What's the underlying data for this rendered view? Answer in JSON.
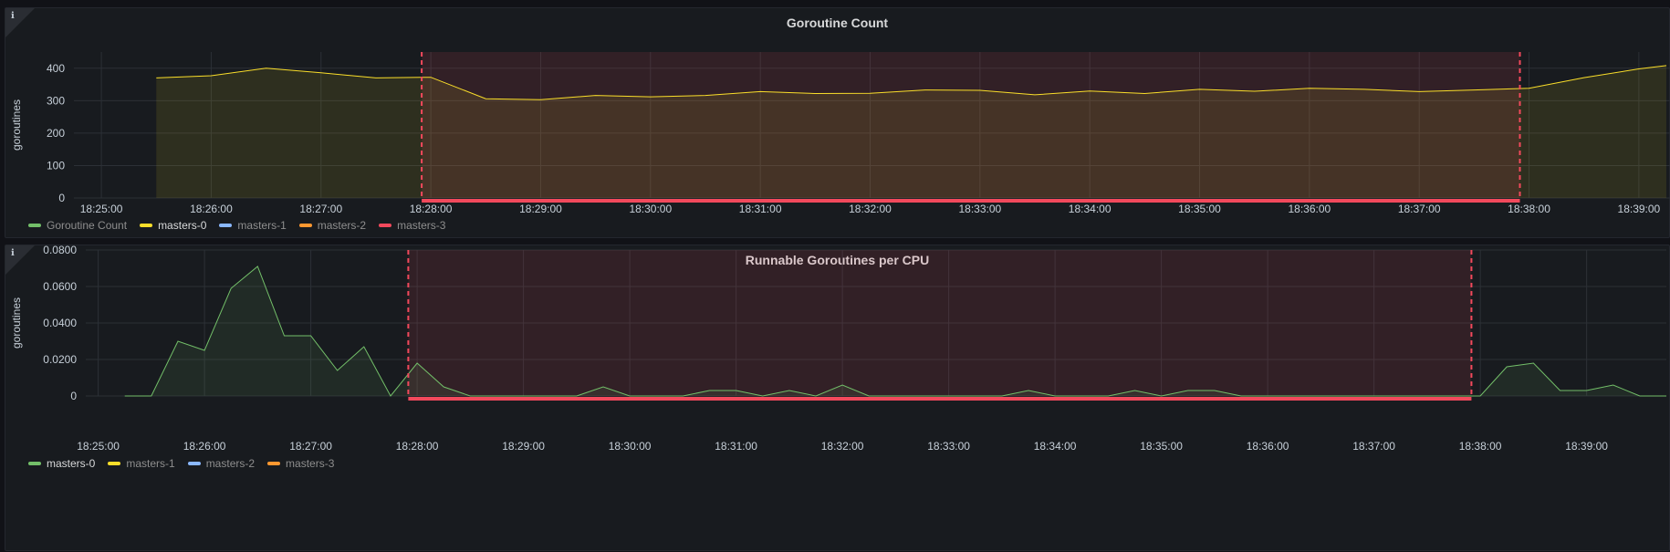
{
  "panels": [
    {
      "title": "Goroutine Count",
      "info_icon": "ℹ",
      "chart_data": {
        "type": "area",
        "title": "Goroutine Count",
        "ylabel": "goroutines",
        "ylim": [
          0,
          450
        ],
        "yticks": [
          0,
          100,
          200,
          300,
          400
        ],
        "ytick_labels": [
          "0",
          "100",
          "200",
          "300",
          "400"
        ],
        "xlim": [
          "18:24:45",
          "18:39:20"
        ],
        "xticks": [
          "18:25:00",
          "18:26:00",
          "18:27:00",
          "18:28:00",
          "18:29:00",
          "18:30:00",
          "18:31:00",
          "18:32:00",
          "18:33:00",
          "18:34:00",
          "18:35:00",
          "18:36:00",
          "18:37:00",
          "18:38:00",
          "18:39:00"
        ],
        "region": {
          "start": "18:27:55",
          "end": "18:37:55",
          "color": "#f2495c"
        },
        "series": [
          {
            "name": "masters-0",
            "color": "#fade2a",
            "x": [
              "18:25:30",
              "18:26:00",
              "18:26:30",
              "18:27:00",
              "18:27:30",
              "18:27:55",
              "18:28:00",
              "18:28:30",
              "18:29:00",
              "18:29:30",
              "18:30:00",
              "18:30:30",
              "18:31:00",
              "18:31:30",
              "18:32:00",
              "18:32:30",
              "18:33:00",
              "18:33:30",
              "18:34:00",
              "18:34:30",
              "18:35:00",
              "18:35:30",
              "18:36:00",
              "18:36:30",
              "18:37:00",
              "18:37:30",
              "18:38:00",
              "18:38:30",
              "18:39:00",
              "18:39:15"
            ],
            "values": [
              370,
              377,
              400,
              386,
              370,
              372,
              372,
              306,
              303,
              316,
              312,
              316,
              328,
              322,
              323,
              333,
              332,
              318,
              330,
              322,
              335,
              329,
              338,
              335,
              328,
              333,
              338,
              371,
              398,
              408
            ]
          }
        ]
      },
      "legend": [
        {
          "label": "Goroutine Count",
          "color": "#73bf69",
          "active": false
        },
        {
          "label": "masters-0",
          "color": "#fade2a",
          "active": true
        },
        {
          "label": "masters-1",
          "color": "#8ab8ff",
          "active": false
        },
        {
          "label": "masters-2",
          "color": "#ff9830",
          "active": false
        },
        {
          "label": "masters-3",
          "color": "#f2495c",
          "active": false
        }
      ]
    },
    {
      "title": "Runnable Goroutines per CPU",
      "info_icon": "ℹ",
      "chart_data": {
        "type": "area",
        "title": "Runnable Goroutines per CPU",
        "ylabel": "goroutines",
        "ylim": [
          0,
          0.08
        ],
        "yticks": [
          0,
          0.02,
          0.04,
          0.06,
          0.08
        ],
        "ytick_labels": [
          "0",
          "0.0200",
          "0.0400",
          "0.0600",
          "0.0800"
        ],
        "xlim": [
          "18:24:53",
          "18:39:45"
        ],
        "xticks": [
          "18:25:00",
          "18:26:00",
          "18:27:00",
          "18:28:00",
          "18:29:00",
          "18:30:00",
          "18:31:00",
          "18:32:00",
          "18:33:00",
          "18:34:00",
          "18:35:00",
          "18:36:00",
          "18:37:00",
          "18:38:00",
          "18:39:00"
        ],
        "region": {
          "start": "18:27:55",
          "end": "18:37:55",
          "color": "#f2495c"
        },
        "series": [
          {
            "name": "masters-0",
            "color": "#73bf69",
            "x": [
              "18:25:15",
              "18:25:30",
              "18:25:45",
              "18:26:00",
              "18:26:15",
              "18:26:30",
              "18:26:45",
              "18:27:00",
              "18:27:15",
              "18:27:30",
              "18:27:45",
              "18:28:00",
              "18:28:15",
              "18:28:30",
              "18:29:00",
              "18:29:30",
              "18:29:45",
              "18:30:00",
              "18:30:30",
              "18:30:45",
              "18:31:00",
              "18:31:15",
              "18:31:30",
              "18:31:45",
              "18:32:00",
              "18:32:15",
              "18:32:30",
              "18:33:00",
              "18:33:30",
              "18:33:45",
              "18:34:00",
              "18:34:30",
              "18:34:45",
              "18:35:00",
              "18:35:15",
              "18:35:30",
              "18:35:45",
              "18:36:00",
              "18:36:30",
              "18:37:00",
              "18:37:30",
              "18:37:45",
              "18:38:00",
              "18:38:15",
              "18:38:30",
              "18:38:45",
              "18:39:00",
              "18:39:15",
              "18:39:30",
              "18:39:45"
            ],
            "values": [
              0,
              0,
              0.03,
              0.025,
              0.059,
              0.071,
              0.033,
              0.033,
              0.014,
              0.027,
              0,
              0.018,
              0.005,
              0,
              0,
              0,
              0.005,
              0,
              0,
              0.003,
              0.003,
              0,
              0.003,
              0,
              0.006,
              0,
              0,
              0,
              0,
              0.003,
              0,
              0,
              0.003,
              0,
              0.003,
              0.003,
              0,
              0,
              0,
              0,
              0,
              0,
              0,
              0.016,
              0.018,
              0.003,
              0.003,
              0.006,
              0,
              0
            ]
          }
        ]
      },
      "legend": [
        {
          "label": "masters-0",
          "color": "#73bf69",
          "active": true
        },
        {
          "label": "masters-1",
          "color": "#fade2a",
          "active": false
        },
        {
          "label": "masters-2",
          "color": "#8ab8ff",
          "active": false
        },
        {
          "label": "masters-3",
          "color": "#ff9830",
          "active": false
        }
      ]
    }
  ]
}
